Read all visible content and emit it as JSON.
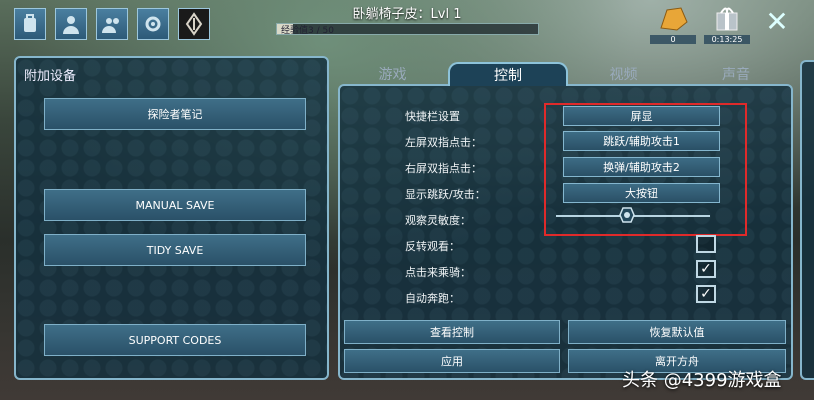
{
  "hud": {
    "title": "卧躺椅子皮：Lvl 1",
    "xp_label": "经验值3 / 50",
    "xp_fraction": 0.06,
    "icons": [
      "backpack-icon",
      "player-icon",
      "tribe-icon",
      "settings-icon",
      "ark-logo-icon"
    ],
    "amber_value": "0",
    "gift_timer": "0:13:25"
  },
  "left_panel": {
    "title": "附加设备",
    "buttons": {
      "notes": "探险者笔记",
      "manual_save": "MANUAL SAVE",
      "tidy_save": "TIDY SAVE",
      "support_codes": "SUPPORT CODES"
    }
  },
  "tabs": [
    "游戏",
    "控制",
    "视频",
    "声音"
  ],
  "active_tab": 1,
  "controls": {
    "rows": [
      {
        "label": "快捷栏设置",
        "value": "屏显"
      },
      {
        "label": "左屏双指点击：",
        "value": "跳跃/辅助攻击1"
      },
      {
        "label": "右屏双指点击：",
        "value": "换弹/辅助攻击2"
      },
      {
        "label": "显示跳跃/攻击：",
        "value": "大按钮"
      }
    ],
    "sensitivity_label": "观察灵敏度：",
    "sensitivity_value": 0.46,
    "checks": [
      {
        "label": "反转观看：",
        "checked": false
      },
      {
        "label": "点击来乘骑：",
        "checked": true
      },
      {
        "label": "自动奔跑：",
        "checked": true
      }
    ]
  },
  "bottom_buttons": {
    "view_controls": "查看控制",
    "restore_defaults": "恢复默认值",
    "apply": "应用",
    "leave_ark": "离开方舟"
  },
  "watermark": "头条 @4399游戏盒",
  "colors": {
    "highlight": "#e02a2a",
    "panel_border": "#86b6cc"
  }
}
